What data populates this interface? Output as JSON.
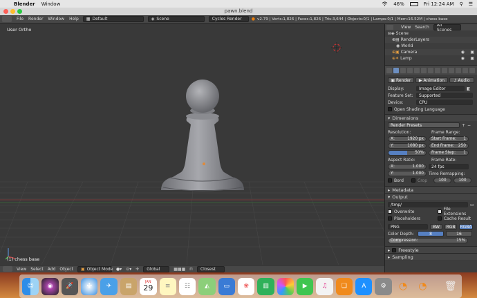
{
  "menubar": {
    "app": "Blender",
    "menu": "Window",
    "wifi_icon": "wifi-icon",
    "battery": "46%",
    "clock": "Fri 12:24 AM"
  },
  "window": {
    "title": "pawn.blend"
  },
  "info": {
    "menus": [
      "File",
      "Render",
      "Window",
      "Help"
    ],
    "layout": "Default",
    "scene": "Scene",
    "engine": "Cycles Render",
    "stats": "v2.79 | Verts:1,826 | Faces:1,826 | Tris:3,644 | Objects:0/1 | Lamps:0/1 | Mem:16.52M | chess base"
  },
  "viewport": {
    "view_label": "User Ortho",
    "object_label": "(1) chess base"
  },
  "view_header": {
    "menus": [
      "View",
      "Select",
      "Add",
      "Object"
    ],
    "mode": "Object Mode",
    "pivot": "Global",
    "snap": "Closest"
  },
  "outliner": {
    "menus": [
      "View",
      "Search",
      "All Scenes"
    ],
    "items": [
      "Scene",
      "RenderLayers",
      "World",
      "Camera",
      "Lamp"
    ]
  },
  "properties": {
    "render_buttons": [
      "Render",
      "Animation",
      "Audio"
    ],
    "display_label": "Display:",
    "display_value": "Image Editor",
    "feature_label": "Feature Set:",
    "feature_value": "Supported",
    "device_label": "Device:",
    "device_value": "CPU",
    "osl_label": "Open Shading Language",
    "dimensions": "Dimensions",
    "render_presets": "Render Presets",
    "resolution": "Resolution:",
    "res_x_label": "X:",
    "res_x": "1920 px",
    "res_y_label": "Y:",
    "res_y": "1080 px",
    "res_pct": "50%",
    "frame_range": "Frame Range:",
    "start_label": "Start Frame:",
    "start": "1",
    "end_label": "End Frame:",
    "end": "250",
    "step_label": "Frame Step:",
    "step": "1",
    "aspect": "Aspect Ratio:",
    "asp_x_label": "X:",
    "asp_x": "1.000",
    "asp_y_label": "Y:",
    "asp_y": "1.000",
    "frame_rate": "Frame Rate:",
    "fps": "24 fps",
    "time_remap": "Time Remapping:",
    "remap_old": "100",
    "remap_new": "100",
    "bord": "Bord",
    "crop": "Crop",
    "metadata": "Metadata",
    "output": "Output",
    "path": "/tmp/",
    "overwrite": "Overwrite",
    "file_ext": "File Extensions",
    "placeholders": "Placeholders",
    "cache": "Cache Result",
    "format": "PNG",
    "bw": "BW",
    "rgb": "RGB",
    "rgba": "RGBA",
    "color_depth_label": "Color Depth:",
    "depth_8": "8",
    "depth_16": "16",
    "compression_label": "Compression:",
    "compression": "15%",
    "freestyle": "Freestyle",
    "sampling": "Sampling"
  },
  "dock": {
    "calendar_month": "JAN",
    "calendar_day": "29"
  }
}
